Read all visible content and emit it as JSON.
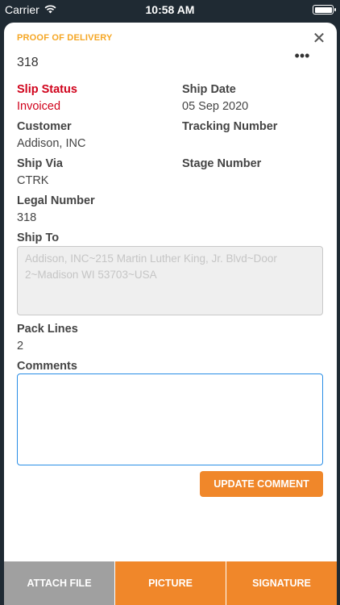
{
  "status_bar": {
    "carrier": "Carrier",
    "time": "10:58 AM",
    "icons": [
      "wifi-icon",
      "battery-icon"
    ]
  },
  "modal": {
    "header_label": "PROOF OF DELIVERY",
    "close_icon": "✕",
    "record_id": "318",
    "more_icon": "•••"
  },
  "fields": {
    "slip_status": {
      "label": "Slip Status",
      "value": "Invoiced"
    },
    "ship_date": {
      "label": "Ship Date",
      "value": "05 Sep 2020"
    },
    "customer": {
      "label": "Customer",
      "value": "Addison, INC"
    },
    "tracking_number": {
      "label": "Tracking Number",
      "value": ""
    },
    "ship_via": {
      "label": "Ship Via",
      "value": "CTRK"
    },
    "stage_number": {
      "label": "Stage Number",
      "value": ""
    },
    "legal_number": {
      "label": "Legal Number",
      "value": "318"
    },
    "ship_to": {
      "label": "Ship To",
      "value": "Addison, INC~215 Martin Luther King, Jr. Blvd~Door 2~Madison WI 53703~USA"
    },
    "pack_lines": {
      "label": "Pack Lines",
      "value": "2"
    },
    "comments": {
      "label": "Comments",
      "value": ""
    }
  },
  "actions": {
    "update_comment": "UPDATE COMMENT"
  },
  "bottom_bar": {
    "attach_file": "ATTACH FILE",
    "picture": "PICTURE",
    "signature": "SIGNATURE"
  },
  "colors": {
    "accent_orange": "#f0872a",
    "header_yellow": "#f5a623",
    "status_red": "#d0021b",
    "focus_blue": "#2a8ee6",
    "disabled_gray": "#a0a0a0"
  }
}
